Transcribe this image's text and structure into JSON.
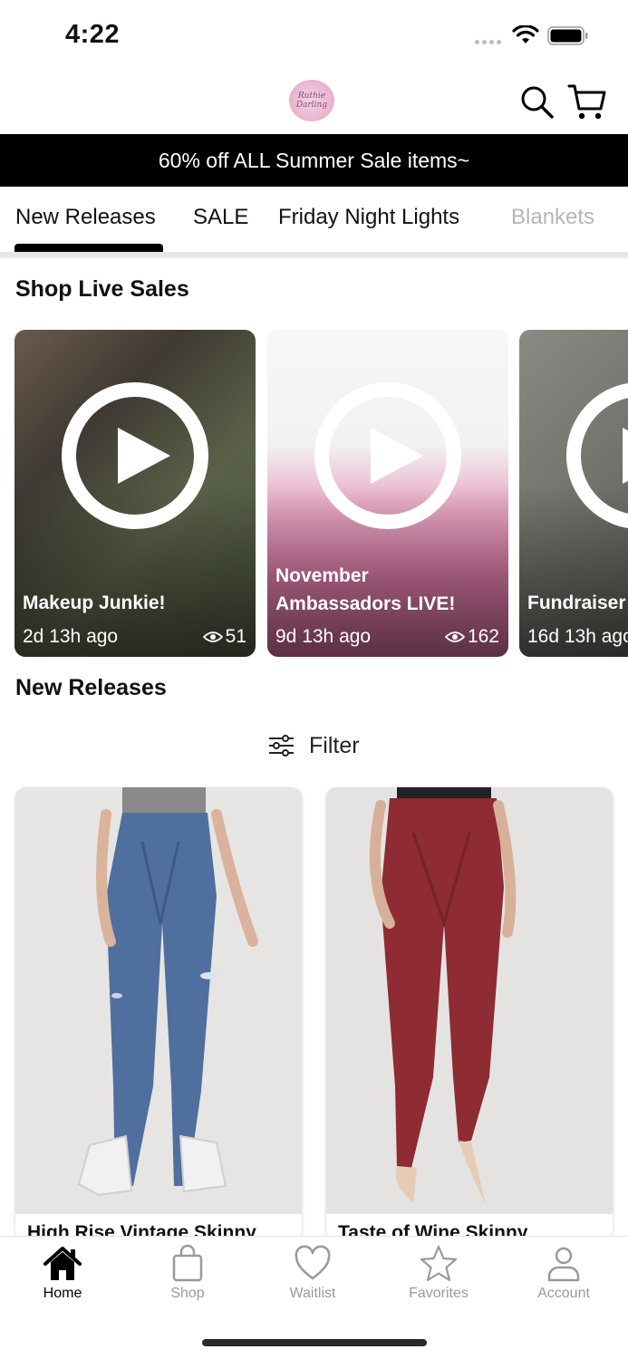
{
  "status_bar": {
    "time": "4:22"
  },
  "header": {
    "logo_text": "Ruthie Darling"
  },
  "promo_banner": {
    "text": "60% off ALL Summer Sale items~"
  },
  "tabs": [
    {
      "label": "New Releases",
      "active": true
    },
    {
      "label": "SALE",
      "active": false
    },
    {
      "label": "Friday Night Lights",
      "active": false
    },
    {
      "label": "Blankets",
      "active": false
    }
  ],
  "live_sales": {
    "title": "Shop Live Sales",
    "items": [
      {
        "title": "Makeup Junkie!",
        "time": "2d 13h ago",
        "views": "51"
      },
      {
        "title": "November Ambassadors LIVE!",
        "title_line1": "November",
        "title_line2": "Ambassadors LIVE!",
        "time": "9d 13h ago",
        "views": "162"
      },
      {
        "title": "Fundraiser",
        "time": "16d 13h ago"
      }
    ]
  },
  "new_releases": {
    "title": "New Releases",
    "filter_label": "Filter",
    "products": [
      {
        "name": "High Rise Vintage Skinny"
      },
      {
        "name": "Taste of Wine Skinny"
      }
    ]
  },
  "bottom_nav": [
    {
      "label": "Home",
      "icon": "home-icon",
      "active": true
    },
    {
      "label": "Shop",
      "icon": "shopping-bag-icon",
      "active": false
    },
    {
      "label": "Waitlist",
      "icon": "heart-icon",
      "active": false
    },
    {
      "label": "Favorites",
      "icon": "star-icon",
      "active": false
    },
    {
      "label": "Account",
      "icon": "person-icon",
      "active": false
    }
  ],
  "colors": {
    "banner_bg": "#000000",
    "accent": "#000000",
    "inactive": "#9a9a9a"
  }
}
